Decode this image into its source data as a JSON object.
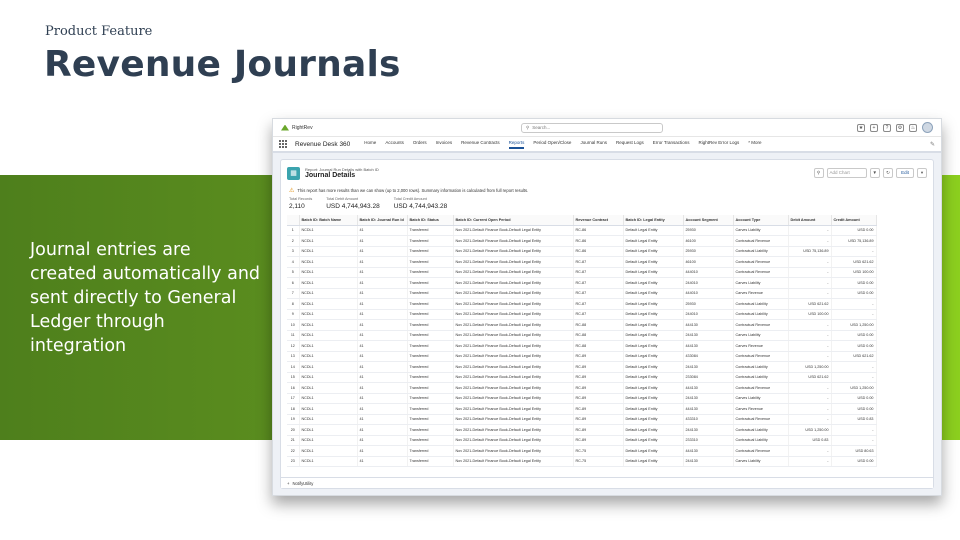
{
  "slide": {
    "eyebrow": "Product Feature",
    "title": "Revenue Journals",
    "body": "Journal entries are created automatically and sent directly to General Ledger through integration"
  },
  "colors": {
    "accent_dark": "#4e7f1c",
    "accent_light": "#8ccf1f",
    "title": "#2f3f52",
    "link": "#1b5297"
  },
  "app": {
    "logo": "RightRev",
    "search_placeholder": "Search...",
    "name": "Revenue Desk 360",
    "nav": [
      "Home",
      "Accounts",
      "Orders",
      "Invoices",
      "Revenue Contracts",
      "Reports",
      "Period Open/Close",
      "Journal Runs",
      "Request Logs",
      "Error Transactions",
      "RightRev Error Logs",
      "* More"
    ],
    "active_nav": "Reports"
  },
  "report": {
    "subtitle": "Report: Journal Run Details with Batch ID",
    "title": "Journal Details",
    "filter_placeholder": "Add Chart",
    "edit_label": "Edit",
    "warning": "This report has more results than we can show (up to 2,000 rows). Summary information is calculated from full report results.",
    "totals": [
      {
        "label": "Total Records",
        "value": "2,110"
      },
      {
        "label": "Total Debit Amount",
        "value": "USD 4,744,943.28"
      },
      {
        "label": "Total Credit Amount",
        "value": "USD 4,744,943.28"
      }
    ],
    "columns": [
      "",
      "Batch ID: Batch Name",
      "Batch ID: Journal Run Id",
      "Batch ID: Status",
      "Batch ID: Current Open Period",
      "Revenue Contract",
      "Batch ID: Legal Entity",
      "Account Segment",
      "Account Type",
      "Debit Amount",
      "Credit Amount"
    ],
    "rows": [
      [
        "1",
        "NCDL1",
        "41",
        "Transferred",
        "Nov 2021-Default Finance Book-Default Legal Entity",
        "RC-86",
        "Default Legal Entity",
        "25930",
        "Carves Liability",
        "-",
        "USD 0.00"
      ],
      [
        "2",
        "NCDL1",
        "41",
        "Transferred",
        "Nov 2021-Default Finance Book-Default Legal Entity",
        "RC-86",
        "Default Legal Entity",
        "46100",
        "Contractual Revenue",
        "-",
        "USD 75,136.89"
      ],
      [
        "3",
        "NCDL1",
        "41",
        "Transferred",
        "Nov 2021-Default Finance Book-Default Legal Entity",
        "RC-86",
        "Default Legal Entity",
        "25930",
        "Contractual Liability",
        "USD 75,136.89",
        "-"
      ],
      [
        "4",
        "NCDL1",
        "41",
        "Transferred",
        "Nov 2021-Default Finance Book-Default Legal Entity",
        "RC-87",
        "Default Legal Entity",
        "46100",
        "Contractual Revenue",
        "-",
        "USD 621.62"
      ],
      [
        "5",
        "NCDL1",
        "41",
        "Transferred",
        "Nov 2021-Default Finance Book-Default Legal Entity",
        "RC-87",
        "Default Legal Entity",
        "444010",
        "Contractual Revenue",
        "-",
        "USD 100.00"
      ],
      [
        "6",
        "NCDL1",
        "41",
        "Transferred",
        "Nov 2021-Default Finance Book-Default Legal Entity",
        "RC-87",
        "Default Legal Entity",
        "244010",
        "Carves Liability",
        "-",
        "USD 0.00"
      ],
      [
        "7",
        "NCDL1",
        "41",
        "Transferred",
        "Nov 2021-Default Finance Book-Default Legal Entity",
        "RC-87",
        "Default Legal Entity",
        "444010",
        "Carves Revenue",
        "-",
        "USD 0.00"
      ],
      [
        "8",
        "NCDL1",
        "41",
        "Transferred",
        "Nov 2021-Default Finance Book-Default Legal Entity",
        "RC-87",
        "Default Legal Entity",
        "25930",
        "Contractual Liability",
        "USD 621.62",
        "-"
      ],
      [
        "9",
        "NCDL1",
        "41",
        "Transferred",
        "Nov 2021-Default Finance Book-Default Legal Entity",
        "RC-87",
        "Default Legal Entity",
        "244010",
        "Contractual Liability",
        "USD 100.00",
        "-"
      ],
      [
        "10",
        "NCDL1",
        "41",
        "Transferred",
        "Nov 2021-Default Finance Book-Default Legal Entity",
        "RC-88",
        "Default Legal Entity",
        "444130",
        "Contractual Revenue",
        "-",
        "USD 1,250.00"
      ],
      [
        "11",
        "NCDL1",
        "41",
        "Transferred",
        "Nov 2021-Default Finance Book-Default Legal Entity",
        "RC-88",
        "Default Legal Entity",
        "244130",
        "Carves Liability",
        "-",
        "USD 0.00"
      ],
      [
        "12",
        "NCDL1",
        "41",
        "Transferred",
        "Nov 2021-Default Finance Book-Default Legal Entity",
        "RC-88",
        "Default Legal Entity",
        "444130",
        "Carves Revenue",
        "-",
        "USD 0.00"
      ],
      [
        "13",
        "NCDL1",
        "41",
        "Transferred",
        "Nov 2021-Default Finance Book-Default Legal Entity",
        "RC-89",
        "Default Legal Entity",
        "433084",
        "Contractual Revenue",
        "-",
        "USD 621.62"
      ],
      [
        "14",
        "NCDL1",
        "41",
        "Transferred",
        "Nov 2021-Default Finance Book-Default Legal Entity",
        "RC-89",
        "Default Legal Entity",
        "244130",
        "Contractual Liability",
        "USD 1,250.00",
        "-"
      ],
      [
        "15",
        "NCDL1",
        "41",
        "Transferred",
        "Nov 2021-Default Finance Book-Default Legal Entity",
        "RC-89",
        "Default Legal Entity",
        "233084",
        "Contractual Liability",
        "USD 621.62",
        "-"
      ],
      [
        "16",
        "NCDL1",
        "41",
        "Transferred",
        "Nov 2021-Default Finance Book-Default Legal Entity",
        "RC-89",
        "Default Legal Entity",
        "444130",
        "Contractual Revenue",
        "-",
        "USD 1,250.00"
      ],
      [
        "17",
        "NCDL1",
        "41",
        "Transferred",
        "Nov 2021-Default Finance Book-Default Legal Entity",
        "RC-89",
        "Default Legal Entity",
        "244130",
        "Carves Liability",
        "-",
        "USD 0.00"
      ],
      [
        "18",
        "NCDL1",
        "41",
        "Transferred",
        "Nov 2021-Default Finance Book-Default Legal Entity",
        "RC-89",
        "Default Legal Entity",
        "444130",
        "Carves Revenue",
        "-",
        "USD 0.00"
      ],
      [
        "19",
        "NCDL1",
        "41",
        "Transferred",
        "Nov 2021-Default Finance Book-Default Legal Entity",
        "RC-89",
        "Default Legal Entity",
        "433310",
        "Contractual Revenue",
        "-",
        "USD 0.83"
      ],
      [
        "20",
        "NCDL1",
        "41",
        "Transferred",
        "Nov 2021-Default Finance Book-Default Legal Entity",
        "RC-89",
        "Default Legal Entity",
        "244130",
        "Contractual Liability",
        "USD 1,250.00",
        "-"
      ],
      [
        "21",
        "NCDL1",
        "41",
        "Transferred",
        "Nov 2021-Default Finance Book-Default Legal Entity",
        "RC-89",
        "Default Legal Entity",
        "233310",
        "Contractual Liability",
        "USD 0.83",
        "-"
      ],
      [
        "22",
        "NCDL1",
        "41",
        "Transferred",
        "Nov 2021-Default Finance Book-Default Legal Entity",
        "RC-75",
        "Default Legal Entity",
        "444130",
        "Contractual Revenue",
        "-",
        "USD 80.63"
      ],
      [
        "23",
        "NCDL1",
        "41",
        "Transferred",
        "Nov 2021-Default Finance Book-Default Legal Entity",
        "RC-75",
        "Default Legal Entity",
        "244130",
        "Carves Liability",
        "-",
        "USD 0.00"
      ]
    ],
    "footer": "NotifyUtility"
  }
}
